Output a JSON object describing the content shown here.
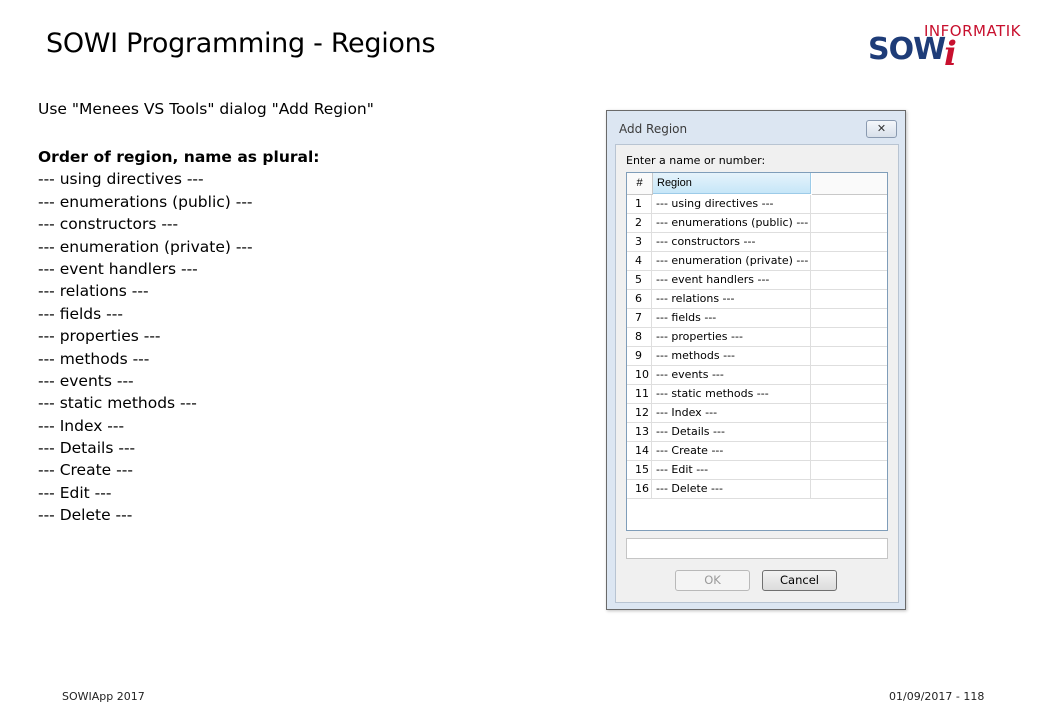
{
  "slide": {
    "title": "SOWI Programming - Regions",
    "intro": "Use \"Menees VS Tools\" dialog \"Add Region\"",
    "order_heading": "Order of region, name as plural:",
    "order_items": [
      "--- using directives ---",
      "--- enumerations (public) ---",
      "--- constructors ---",
      "--- enumeration (private) ---",
      "--- event handlers ---",
      "--- relations ---",
      "--- fields ---",
      "--- properties ---",
      "--- methods ---",
      "--- events ---",
      "--- static methods ---",
      "--- Index ---",
      "--- Details ---",
      "--- Create ---",
      "--- Edit ---",
      "--- Delete ---"
    ]
  },
  "logo": {
    "top_text": "INFORMATIK",
    "main_text": "SOW",
    "mark_text": "i",
    "colors": {
      "blue": "#1e3c78",
      "red": "#c8102e"
    }
  },
  "dialog": {
    "title": "Add Region",
    "close_glyph": "✕",
    "prompt": "Enter a name or number:",
    "columns": [
      "#",
      "Region"
    ],
    "rows": [
      {
        "num": "1",
        "region": "--- using directives ---"
      },
      {
        "num": "2",
        "region": "--- enumerations (public) ---"
      },
      {
        "num": "3",
        "region": "--- constructors ---"
      },
      {
        "num": "4",
        "region": "--- enumeration (private) ---"
      },
      {
        "num": "5",
        "region": "--- event handlers ---"
      },
      {
        "num": "6",
        "region": "--- relations ---"
      },
      {
        "num": "7",
        "region": "--- fields ---"
      },
      {
        "num": "8",
        "region": "--- properties ---"
      },
      {
        "num": "9",
        "region": "--- methods ---"
      },
      {
        "num": "10",
        "region": "--- events ---"
      },
      {
        "num": "11",
        "region": "--- static methods ---"
      },
      {
        "num": "12",
        "region": "--- Index ---"
      },
      {
        "num": "13",
        "region": "--- Details ---"
      },
      {
        "num": "14",
        "region": "--- Create ---"
      },
      {
        "num": "15",
        "region": "--- Edit ---"
      },
      {
        "num": "16",
        "region": "--- Delete ---"
      }
    ],
    "input_value": "",
    "ok_label": "OK",
    "cancel_label": "Cancel"
  },
  "footer": {
    "left": "SOWIApp 2017",
    "right": "01/09/2017 - 118"
  }
}
